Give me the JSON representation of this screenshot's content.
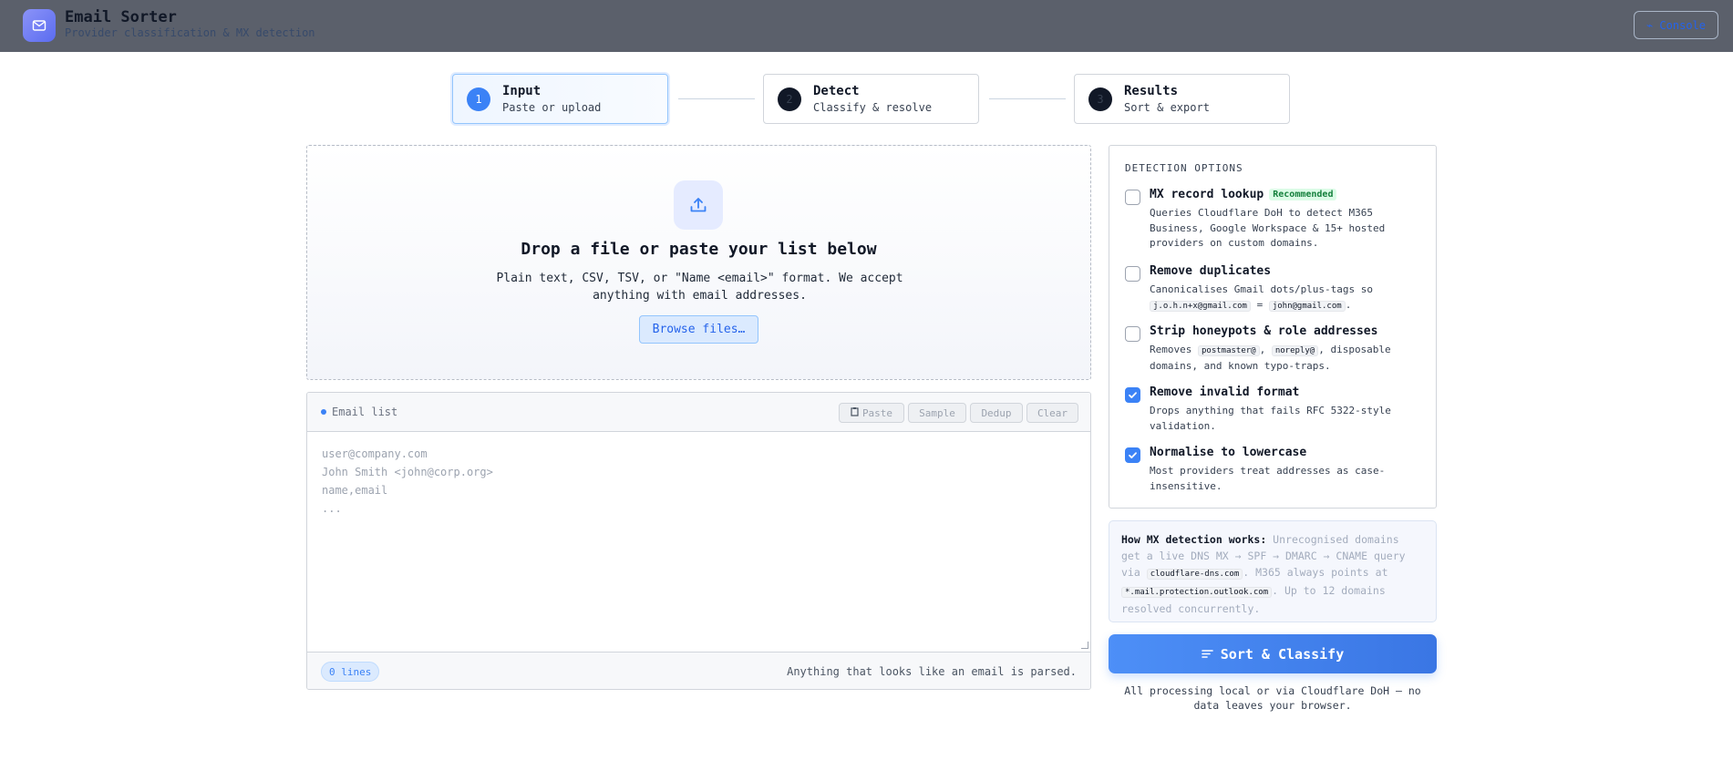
{
  "header": {
    "title": "Email Sorter",
    "subtitle": "Provider classification & MX detection",
    "console_label": "⌁ Console"
  },
  "steps": [
    {
      "num": "1",
      "title": "Input",
      "sub": "Paste or upload"
    },
    {
      "num": "2",
      "title": "Detect",
      "sub": "Classify & resolve"
    },
    {
      "num": "3",
      "title": "Results",
      "sub": "Sort & export"
    }
  ],
  "dropzone": {
    "title": "Drop a file or paste your list below",
    "description": "Plain text, CSV, TSV, or \"Name <email>\" format. We accept anything with email addresses.",
    "browse_label": "Browse files…"
  },
  "email_list": {
    "label": "Email list",
    "buttons": {
      "paste": "Paste",
      "sample": "Sample",
      "dedup": "Dedup",
      "clear": "Clear"
    },
    "placeholder_lines": [
      "user@company.com",
      "John Smith <john@corp.org>",
      "name,email",
      "..."
    ],
    "lines_count": "0 lines",
    "footer_note": "Anything that looks like an email is parsed."
  },
  "options": {
    "heading": "DETECTION OPTIONS",
    "mx": {
      "title": "MX record lookup",
      "badge": "Recommended",
      "desc": "Queries Cloudflare DoH to detect M365 Business, Google Workspace & 15+ hosted providers on custom domains.",
      "checked": false
    },
    "dups": {
      "title": "Remove duplicates",
      "desc_pre": "Canonicalises Gmail dots/plus-tags so ",
      "code1": "j.o.h.n+x@gmail.com",
      "desc_mid": " = ",
      "code2": "john@gmail.com",
      "desc_post": ".",
      "checked": false
    },
    "honeypots": {
      "title": "Strip honeypots & role addresses",
      "desc_pre": "Removes ",
      "code1": "postmaster@",
      "desc_mid": ", ",
      "code2": "noreply@",
      "desc_post": ", disposable domains, and known typo-traps.",
      "checked": false
    },
    "invalid": {
      "title": "Remove invalid format",
      "desc": "Drops anything that fails RFC 5322-style validation.",
      "checked": true
    },
    "lowercase": {
      "title": "Normalise to lowercase",
      "desc": "Most providers treat addresses as case-insensitive.",
      "checked": true
    }
  },
  "info": {
    "lead": "How MX detection works:",
    "text1": " Unrecognised domains get a live DNS MX → SPF → DMARC → CNAME query via ",
    "code1": "cloudflare-dns.com",
    "text2": ". M365 always points at ",
    "code2": "*.mail.protection.outlook.com",
    "text3": ". Up to 12 domains resolved concurrently."
  },
  "sort_button": "Sort & Classify",
  "privacy_note": "All processing local or via Cloudflare DoH — no data leaves your browser.",
  "colors": {
    "accent": "#3b82f6",
    "header_bg": "#5b606b",
    "success": "#15803d"
  }
}
